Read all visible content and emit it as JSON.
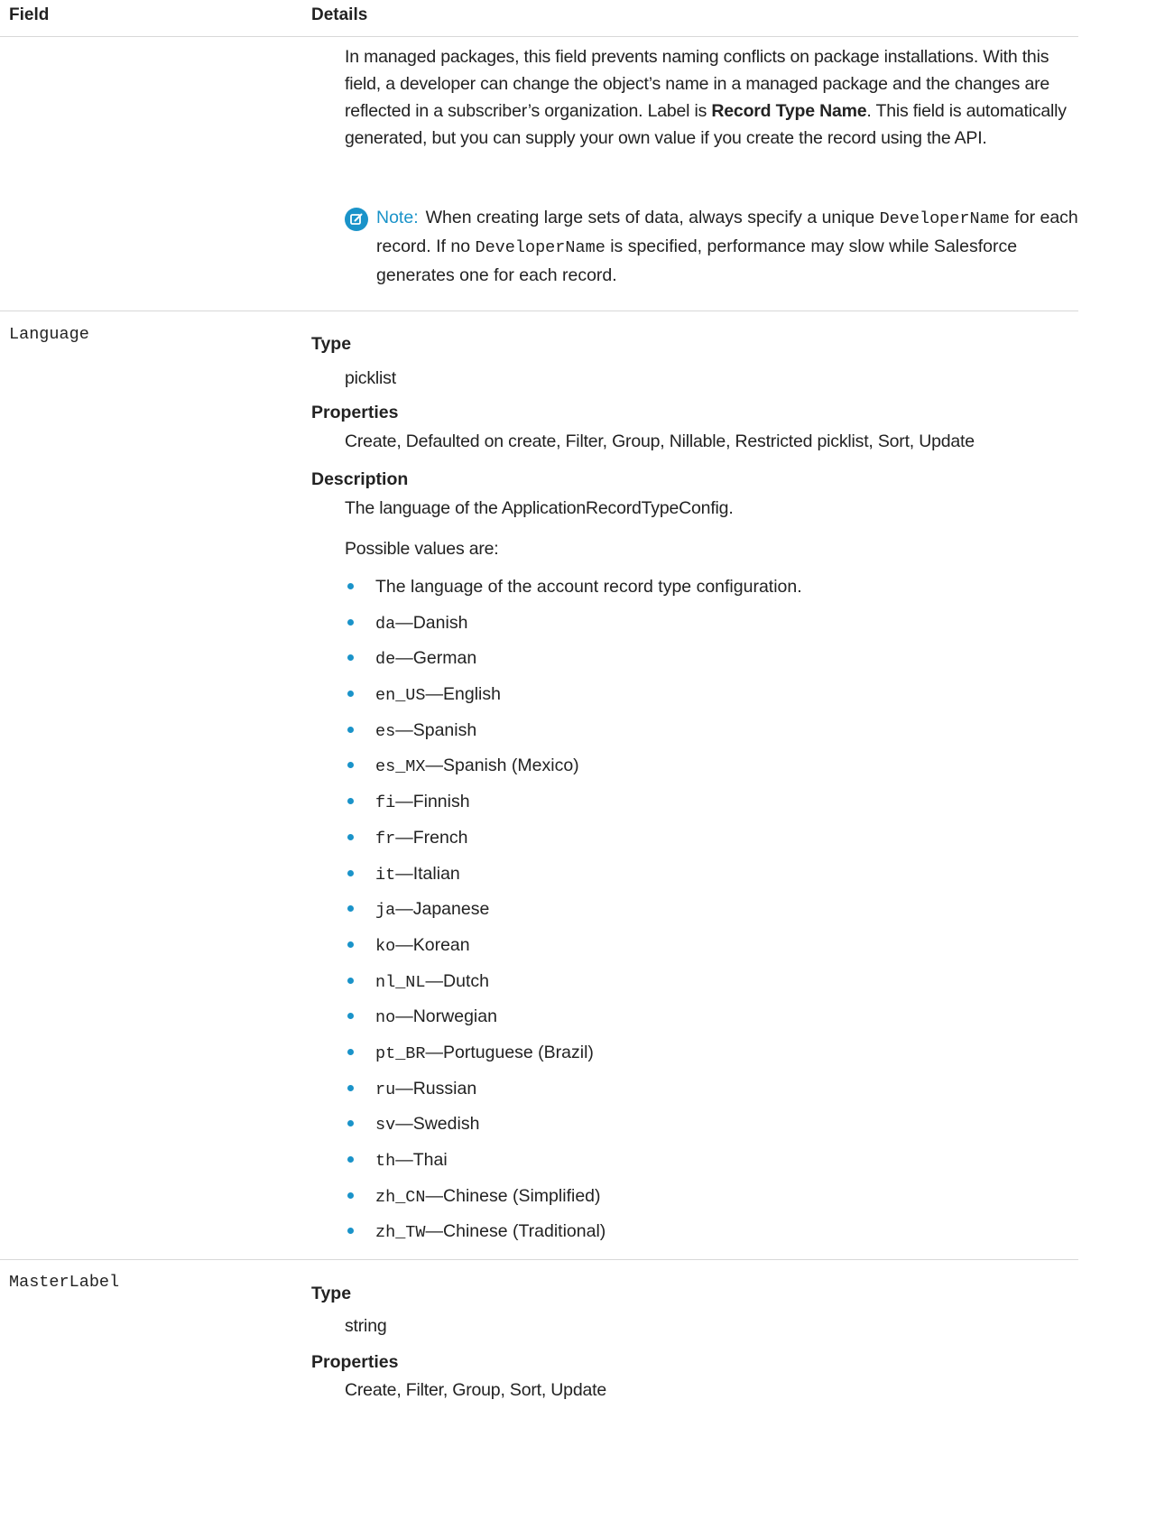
{
  "table": {
    "headers": {
      "field": "Field",
      "details": "Details"
    }
  },
  "developer_name": {
    "paragraph_1": "In managed packages, this field prevents naming conflicts on package installations. With this field, a developer can change the object’s name in a managed package and the changes are reflected in a subscriber’s organization. Label is ",
    "paragraph_bold": "Record Type Name",
    "paragraph_2": ". This field is automatically generated, but you can supply your own value if you create the record using the API.",
    "note": {
      "icon": "edit-note-icon",
      "label": "Note:",
      "text_1": "When creating large sets of data, always specify a unique ",
      "code_1": "DeveloperName",
      "text_2": " for each record. If no ",
      "code_2": "DeveloperName",
      "text_3": " is specified, performance may slow while Salesforce generates one for each record."
    }
  },
  "language": {
    "name": "Language",
    "type_label": "Type",
    "type_value": "picklist",
    "properties_label": "Properties",
    "properties_value": "Create, Defaulted on create, Filter, Group, Nillable, Restricted picklist, Sort, Update",
    "description_label": "Description",
    "description_value": "The language of the ApplicationRecordTypeConfig.",
    "possible_values_intro": "Possible values are:",
    "values": [
      {
        "code": "",
        "text": "The language of the account record type configuration."
      },
      {
        "code": "da",
        "text": "—Danish"
      },
      {
        "code": "de",
        "text": "—German"
      },
      {
        "code": "en_US",
        "text": "—English"
      },
      {
        "code": "es",
        "text": "—Spanish"
      },
      {
        "code": "es_MX",
        "text": "—Spanish (Mexico)"
      },
      {
        "code": "fi",
        "text": "—Finnish"
      },
      {
        "code": "fr",
        "text": "—French"
      },
      {
        "code": "it",
        "text": "—Italian"
      },
      {
        "code": "ja",
        "text": "—Japanese"
      },
      {
        "code": "ko",
        "text": "—Korean"
      },
      {
        "code": "nl_NL",
        "text": "—Dutch"
      },
      {
        "code": "no",
        "text": "—Norwegian"
      },
      {
        "code": "pt_BR",
        "text": "—Portuguese (Brazil)"
      },
      {
        "code": "ru",
        "text": "—Russian"
      },
      {
        "code": "sv",
        "text": "—Swedish"
      },
      {
        "code": "th",
        "text": "—Thai"
      },
      {
        "code": "zh_CN",
        "text": "—Chinese (Simplified)"
      },
      {
        "code": "zh_TW",
        "text": "—Chinese (Traditional)"
      }
    ]
  },
  "master_label": {
    "name": "MasterLabel",
    "type_label": "Type",
    "type_value": "string",
    "properties_label": "Properties",
    "properties_value": "Create, Filter, Group, Sort, Update"
  },
  "colors": {
    "accent": "#1a93c9",
    "divider": "#d8d8d8",
    "text": "#222222"
  }
}
